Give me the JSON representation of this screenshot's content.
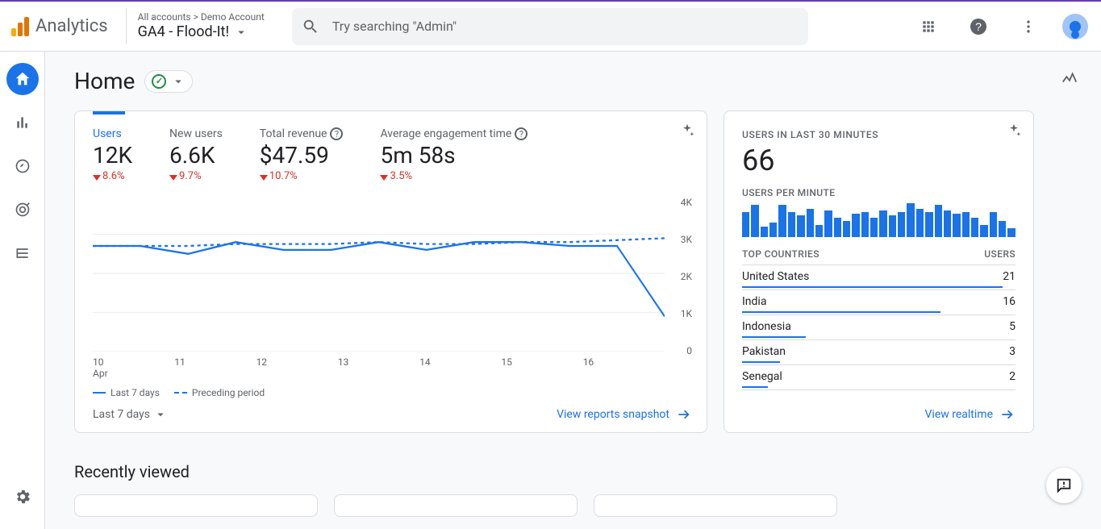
{
  "header": {
    "product": "Analytics",
    "account_path": "All accounts > Demo Account",
    "property": "GA4 - Flood-It!",
    "search_placeholder": "Try searching \"Admin\""
  },
  "page": {
    "title": "Home",
    "recently_viewed_title": "Recently viewed"
  },
  "overview": {
    "date_range_label": "Last 7 days",
    "snapshot_link": "View reports snapshot",
    "legend_current": "Last 7 days",
    "legend_prev": "Preceding period",
    "metrics": [
      {
        "label": "Users",
        "value": "12K",
        "delta": "8.6%",
        "active": true,
        "help": false
      },
      {
        "label": "New users",
        "value": "6.6K",
        "delta": "9.7%",
        "active": false,
        "help": false
      },
      {
        "label": "Total revenue",
        "value": "$47.59",
        "delta": "10.7%",
        "active": false,
        "help": true
      },
      {
        "label": "Average engagement time",
        "value": "5m 58s",
        "delta": "3.5%",
        "active": false,
        "help": true
      }
    ]
  },
  "realtime": {
    "label": "USERS IN LAST 30 MINUTES",
    "value": "66",
    "per_min_label": "USERS PER MINUTE",
    "countries_label": "TOP COUNTRIES",
    "users_label": "USERS",
    "link": "View realtime",
    "countries": [
      {
        "name": "United States",
        "users": 21
      },
      {
        "name": "India",
        "users": 16
      },
      {
        "name": "Indonesia",
        "users": 5
      },
      {
        "name": "Pakistan",
        "users": 3
      },
      {
        "name": "Senegal",
        "users": 2
      }
    ]
  },
  "chart_data": {
    "type": "line",
    "xlabel": "Apr",
    "ylabel": "",
    "ylim": [
      0,
      4000
    ],
    "y_ticks": [
      "4K",
      "3K",
      "2K",
      "1K",
      "0"
    ],
    "x_ticks": [
      "10",
      "11",
      "12",
      "13",
      "14",
      "15",
      "16"
    ],
    "series": [
      {
        "name": "Last 7 days",
        "style": "solid",
        "values": [
          2700,
          2700,
          2500,
          2800,
          2600,
          2600,
          2800,
          2600,
          2800,
          2800,
          2700,
          2700,
          900
        ]
      },
      {
        "name": "Preceding period",
        "style": "dashed",
        "values": [
          2700,
          2700,
          2700,
          2750,
          2750,
          2750,
          2800,
          2750,
          2750,
          2800,
          2800,
          2850,
          2900
        ]
      }
    ],
    "realtime_bars": [
      28,
      36,
      12,
      16,
      36,
      28,
      24,
      32,
      14,
      30,
      22,
      18,
      26,
      28,
      22,
      30,
      24,
      28,
      38,
      32,
      28,
      36,
      30,
      26,
      28,
      22,
      14,
      28,
      18,
      10
    ]
  }
}
